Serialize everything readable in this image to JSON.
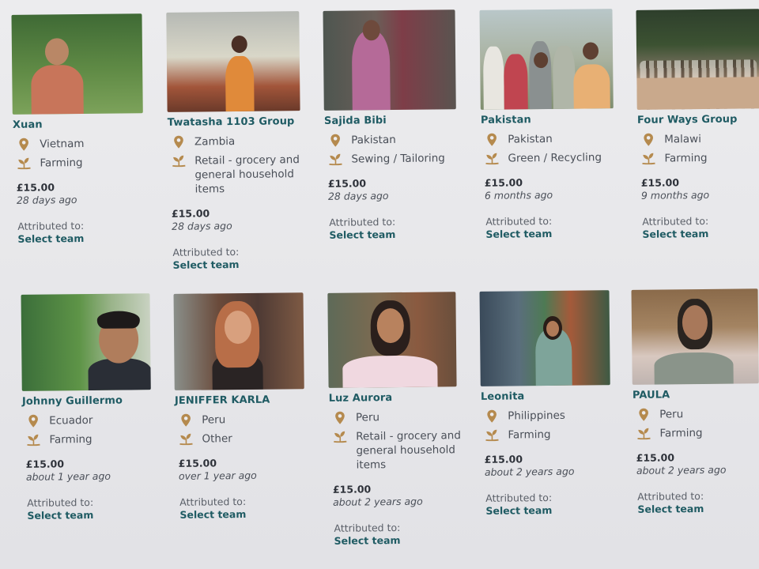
{
  "labels": {
    "attributed": "Attributed to:",
    "select_team": "Select team"
  },
  "icons": {
    "location": "map-pin-icon",
    "sector": "sprout-icon"
  },
  "colors": {
    "accent": "#1f5b63",
    "icon": "#b58a4e"
  },
  "cards": [
    {
      "name": "Xuan",
      "country": "Vietnam",
      "sector": "Farming",
      "amount": "£15.00",
      "time": "28 days ago"
    },
    {
      "name": "Twatasha 1103 Group",
      "country": "Zambia",
      "sector": "Retail - grocery and general household items",
      "amount": "£15.00",
      "time": "28 days ago"
    },
    {
      "name": "Sajida Bibi",
      "country": "Pakistan",
      "sector": "Sewing / Tailoring",
      "amount": "£15.00",
      "time": "28 days ago"
    },
    {
      "name": "Pakistan",
      "country": "Pakistan",
      "sector": "Green / Recycling",
      "amount": "£15.00",
      "time": "6 months ago"
    },
    {
      "name": "Four Ways Group",
      "country": "Malawi",
      "sector": "Farming",
      "amount": "£15.00",
      "time": "9 months ago"
    },
    {
      "name": "Johnny Guillermo",
      "country": "Ecuador",
      "sector": "Farming",
      "amount": "£15.00",
      "time": "about 1 year ago"
    },
    {
      "name": "JENIFFER KARLA",
      "country": "Peru",
      "sector": "Other",
      "amount": "£15.00",
      "time": "over 1 year ago"
    },
    {
      "name": "Luz Aurora",
      "country": "Peru",
      "sector": "Retail - grocery and general household items",
      "amount": "£15.00",
      "time": "about 2 years ago"
    },
    {
      "name": "Leonita",
      "country": "Philippines",
      "sector": "Farming",
      "amount": "£15.00",
      "time": "about 2 years ago"
    },
    {
      "name": "PAULA",
      "country": "Peru",
      "sector": "Farming",
      "amount": "£15.00",
      "time": "about 2 years ago"
    }
  ]
}
